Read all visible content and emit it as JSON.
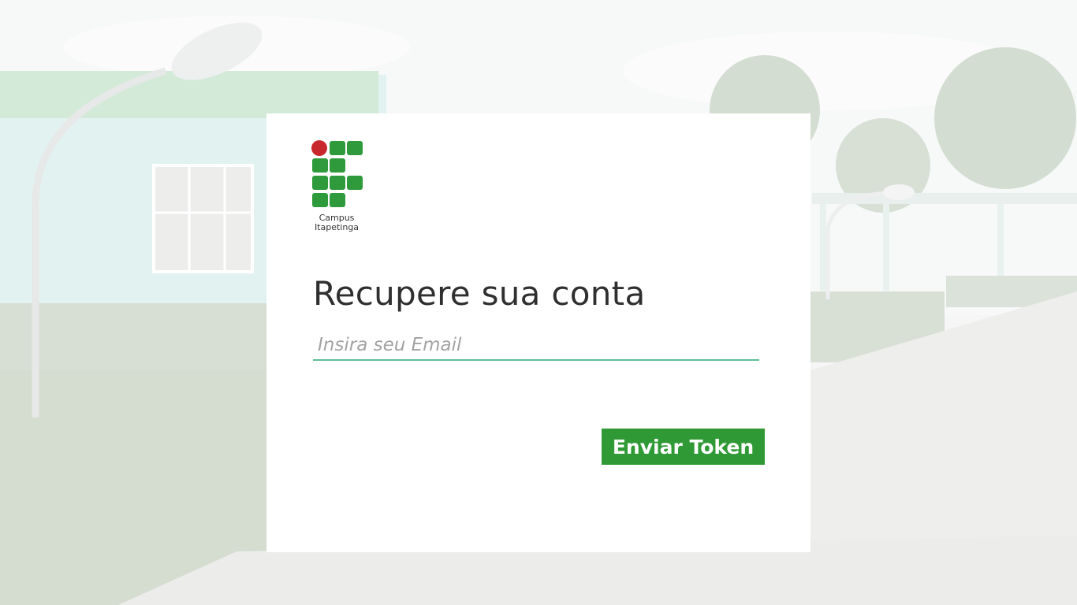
{
  "logo": {
    "caption_line1": "Campus",
    "caption_line2": "Itapetinga",
    "colors": {
      "red": "#c8282d",
      "green": "#2f9a3c"
    }
  },
  "form": {
    "title": "Recupere sua conta",
    "email_placeholder": "Insira seu Email",
    "email_value": "",
    "submit_label": "Enviar Token"
  },
  "colors": {
    "accent_green": "#2f9a35",
    "input_underline": "#5fbf98"
  }
}
